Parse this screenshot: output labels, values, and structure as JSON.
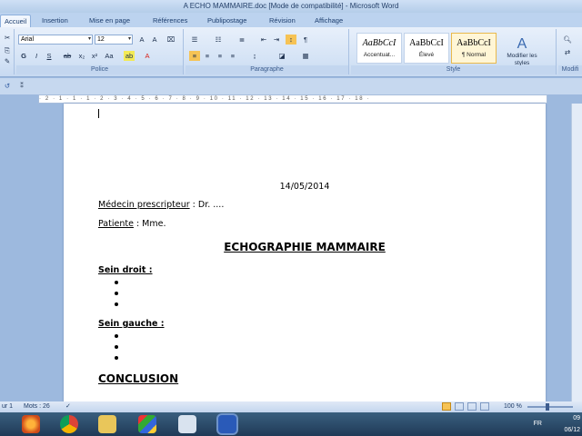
{
  "window": {
    "title": "A ECHO MAMMAIRE.doc [Mode de compatibilité] - Microsoft Word"
  },
  "ribbon_tabs": [
    "Accueil",
    "Insertion",
    "Mise en page",
    "Références",
    "Publipostage",
    "Révision",
    "Affichage"
  ],
  "font": {
    "name": "Arial",
    "size": "12"
  },
  "groups": {
    "police": "Police",
    "paragraphe": "Paragraphe",
    "style": "Style",
    "modifier": "Modifi"
  },
  "styles": [
    {
      "sample": "AaBbCcI",
      "name": "Accentuat..."
    },
    {
      "sample": "AaBbCcI",
      "name": "Élevé"
    },
    {
      "sample": "AaBbCcI",
      "name": "¶ Normal"
    }
  ],
  "modify_styles_label": "Modifier les styles",
  "ruler_text": "· 2 · 1 · 1 · 1 · 2 · 3 · 4 · 5 · 6 · 7 · 8 · 9 · 10 · 11 · 12 · 13 · 14 · 15 · 16 · 17 · 18 ·",
  "document": {
    "date": "14/05/2014",
    "medecin_label": "Médecin prescripteur",
    "medecin_value": " : Dr. ....",
    "patiente_label": "Patiente",
    "patiente_value": " : Mme.",
    "title": "ECHOGRAPHIE MAMMAIRE",
    "sein_droit": "Sein droit :",
    "sein_gauche": "Sein gauche :",
    "conclusion": "CONCLUSION"
  },
  "status": {
    "page": "ur 1",
    "words": "Mots : 26",
    "zoom": "100 %"
  },
  "tray": {
    "lang": "FR",
    "time": "09",
    "date": "06/12"
  }
}
